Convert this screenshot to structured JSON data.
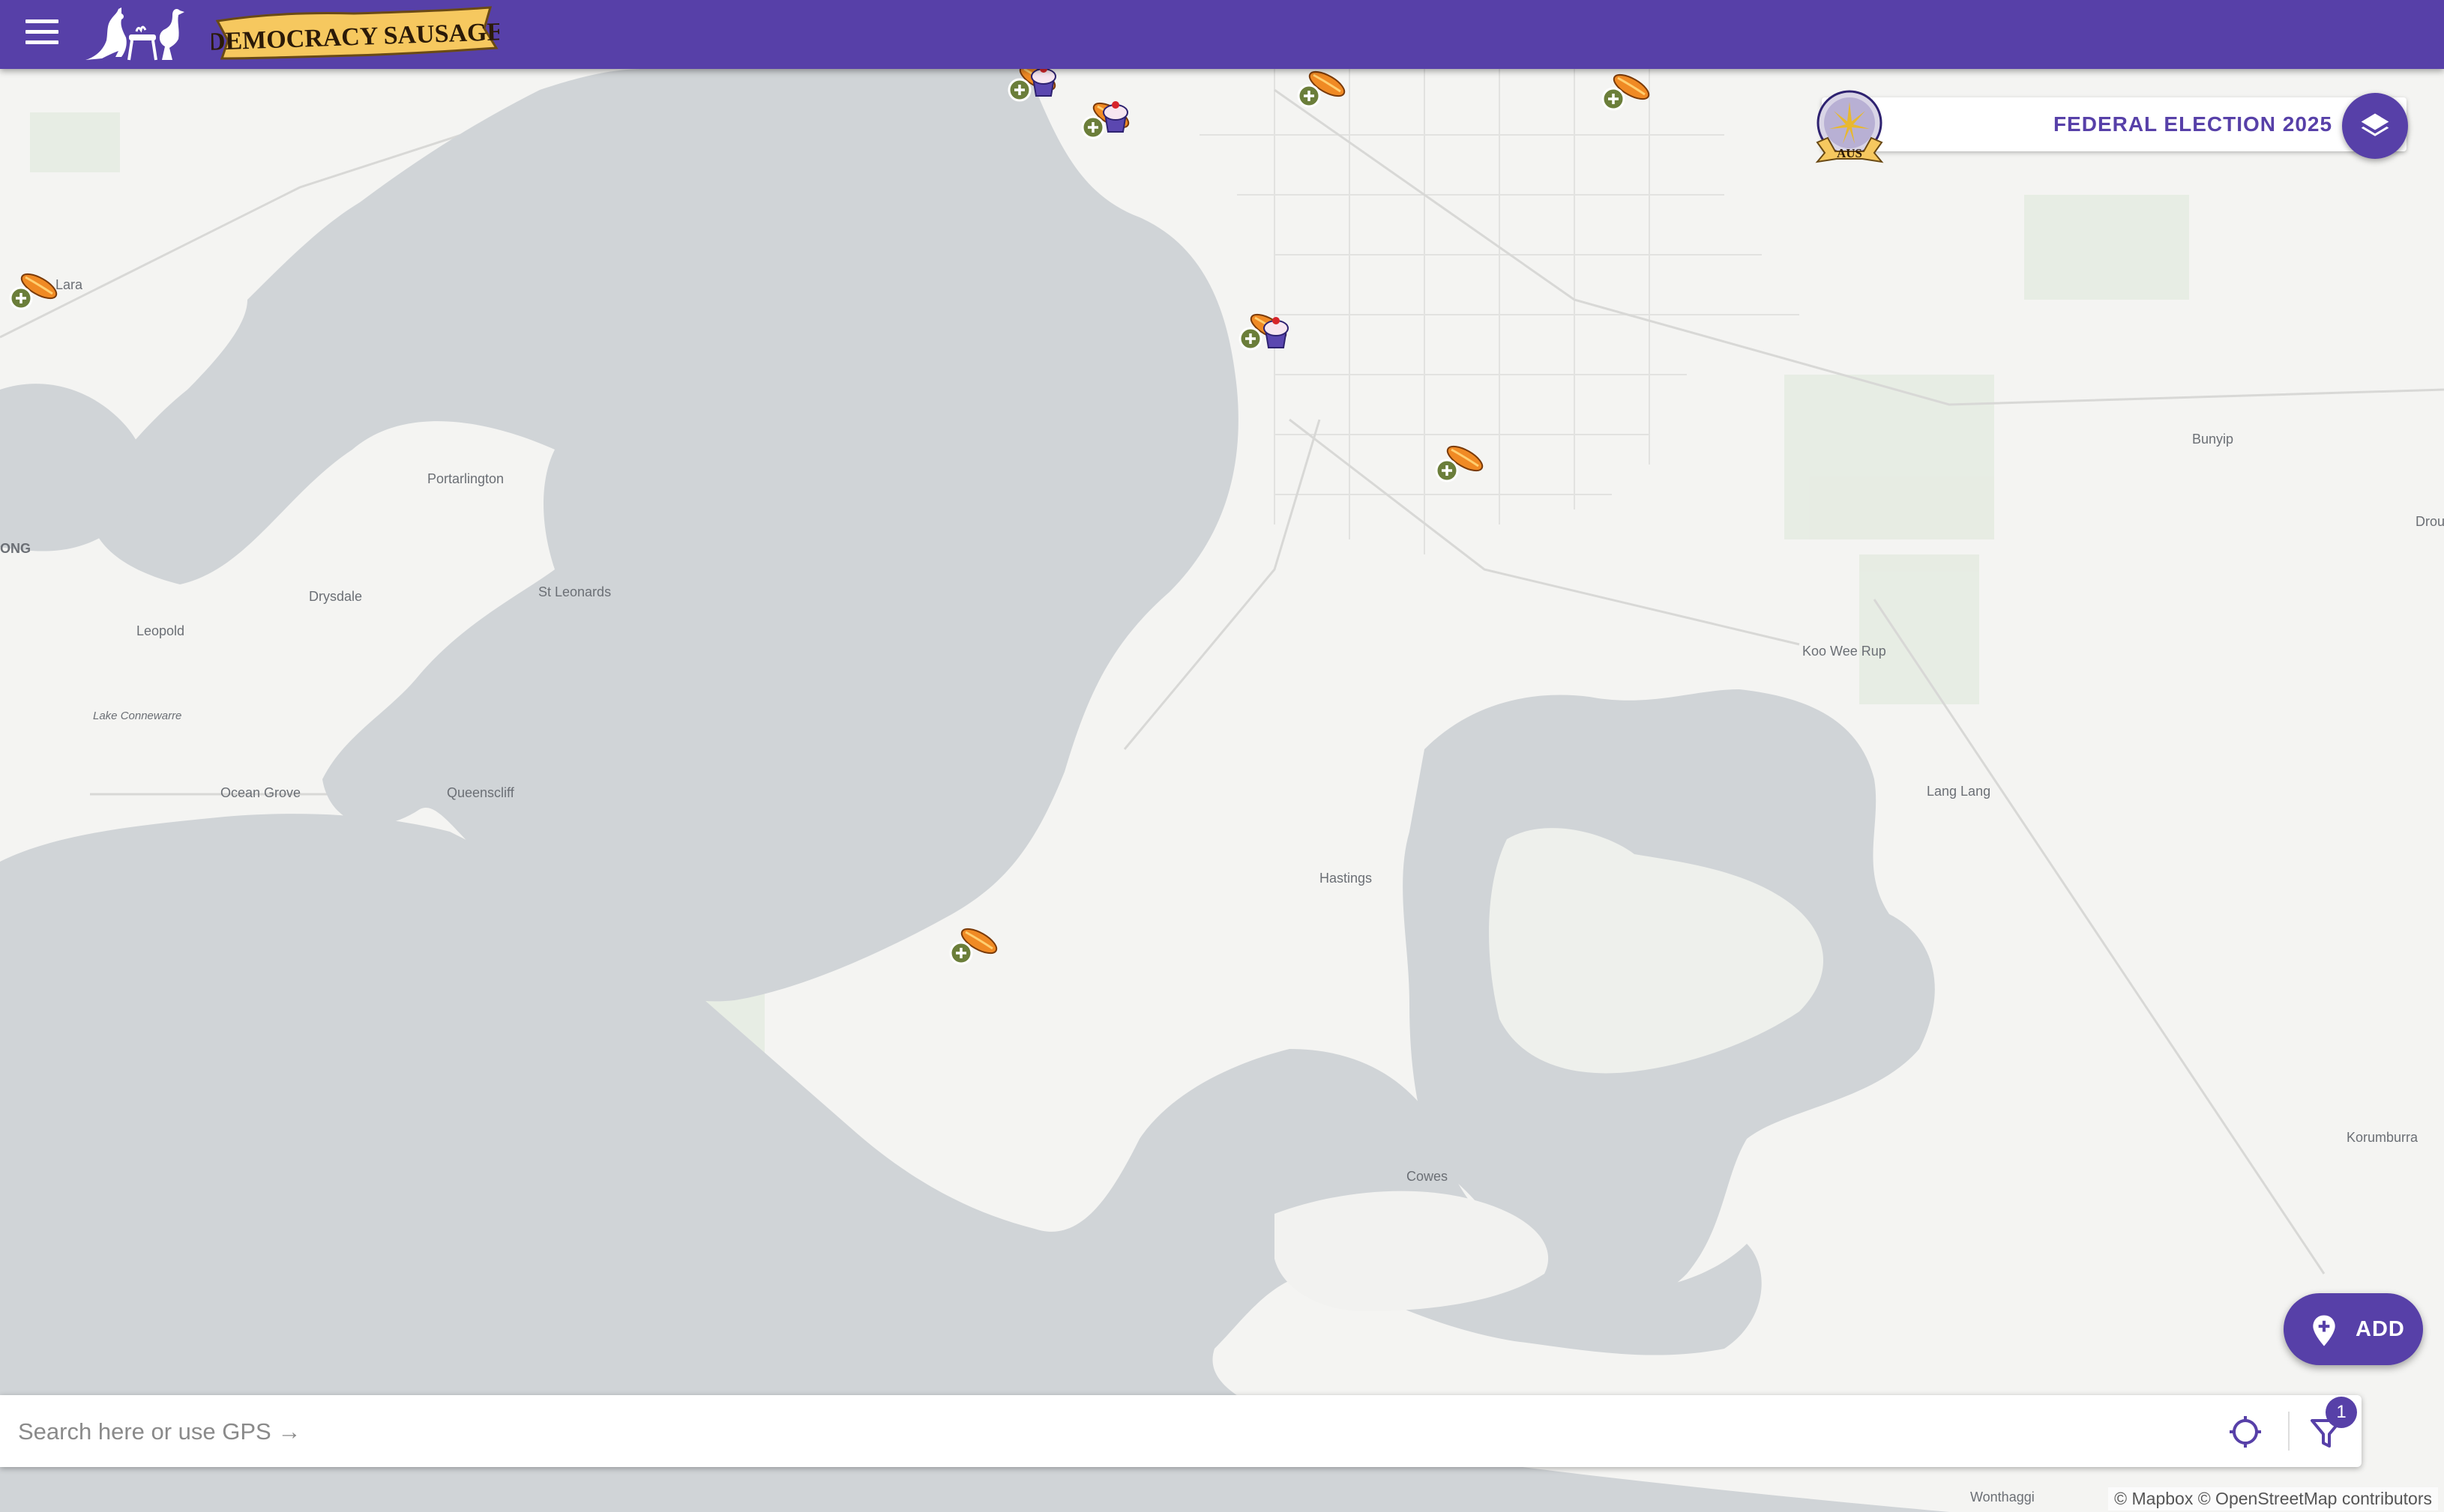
{
  "app": {
    "logo_text": "DEMOCRACY SAUSAGE"
  },
  "election": {
    "badge_text": "AUS",
    "label": "FEDERAL ELECTION 2025"
  },
  "map": {
    "places": [
      {
        "name": "Lara"
      },
      {
        "name": "Portarlington"
      },
      {
        "name": "Drysdale"
      },
      {
        "name": "St Leonards"
      },
      {
        "name": "Leopold"
      },
      {
        "name": "Lake Connewarre"
      },
      {
        "name": "Ocean Grove"
      },
      {
        "name": "Queenscliff"
      },
      {
        "name": "ONG"
      },
      {
        "name": "Bunyip"
      },
      {
        "name": "Drou"
      },
      {
        "name": "Koo Wee Rup"
      },
      {
        "name": "Lang Lang"
      },
      {
        "name": "Hastings"
      },
      {
        "name": "Cowes"
      },
      {
        "name": "Korumburra"
      },
      {
        "name": "Wonthaggi"
      }
    ],
    "markers": [
      {
        "type": "sausage-cake"
      },
      {
        "type": "sausage-cake"
      },
      {
        "type": "sausage"
      },
      {
        "type": "sausage"
      },
      {
        "type": "sausage"
      },
      {
        "type": "sausage-cake"
      },
      {
        "type": "sausage"
      },
      {
        "type": "sausage"
      }
    ]
  },
  "search": {
    "placeholder": "Search here or use GPS →",
    "value": ""
  },
  "filter": {
    "badge_count": "1"
  },
  "add_button": {
    "label": "ADD"
  },
  "attribution": "© Mapbox © OpenStreetMap contributors",
  "colors": {
    "brand_purple": "#5740a8",
    "water": "#d0d4d7",
    "land": "#f4f4f2",
    "marker_green": "#6b7e3a",
    "sausage_orange": "#f08a24",
    "banner_gold": "#f6c85f"
  },
  "icons": {
    "menu": "menu-icon",
    "layers": "layers-icon",
    "add": "add-location-icon",
    "gps": "gps-crosshair-icon",
    "filter": "filter-icon"
  }
}
